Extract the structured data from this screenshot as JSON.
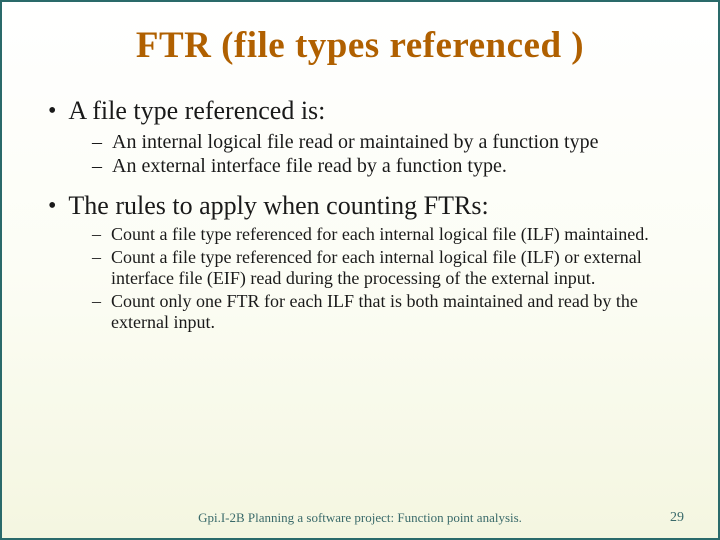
{
  "title": "FTR (file types referenced )",
  "section1": {
    "heading": "A file type referenced is:",
    "items": [
      "An internal logical file read or maintained by a function type",
      "An external interface file read by a function type."
    ]
  },
  "section2": {
    "heading": "The rules to apply when counting FTRs:",
    "items": [
      "Count a file type referenced for each internal logical file (ILF) maintained.",
      "Count a file type referenced for each internal logical file (ILF) or external interface file (EIF) read during the processing of the external input.",
      "Count only one FTR for each ILF that is both maintained and read by the external input."
    ]
  },
  "footer": {
    "text": "Gpi.I-2B Planning a software project: Function point analysis.",
    "page": "29"
  }
}
